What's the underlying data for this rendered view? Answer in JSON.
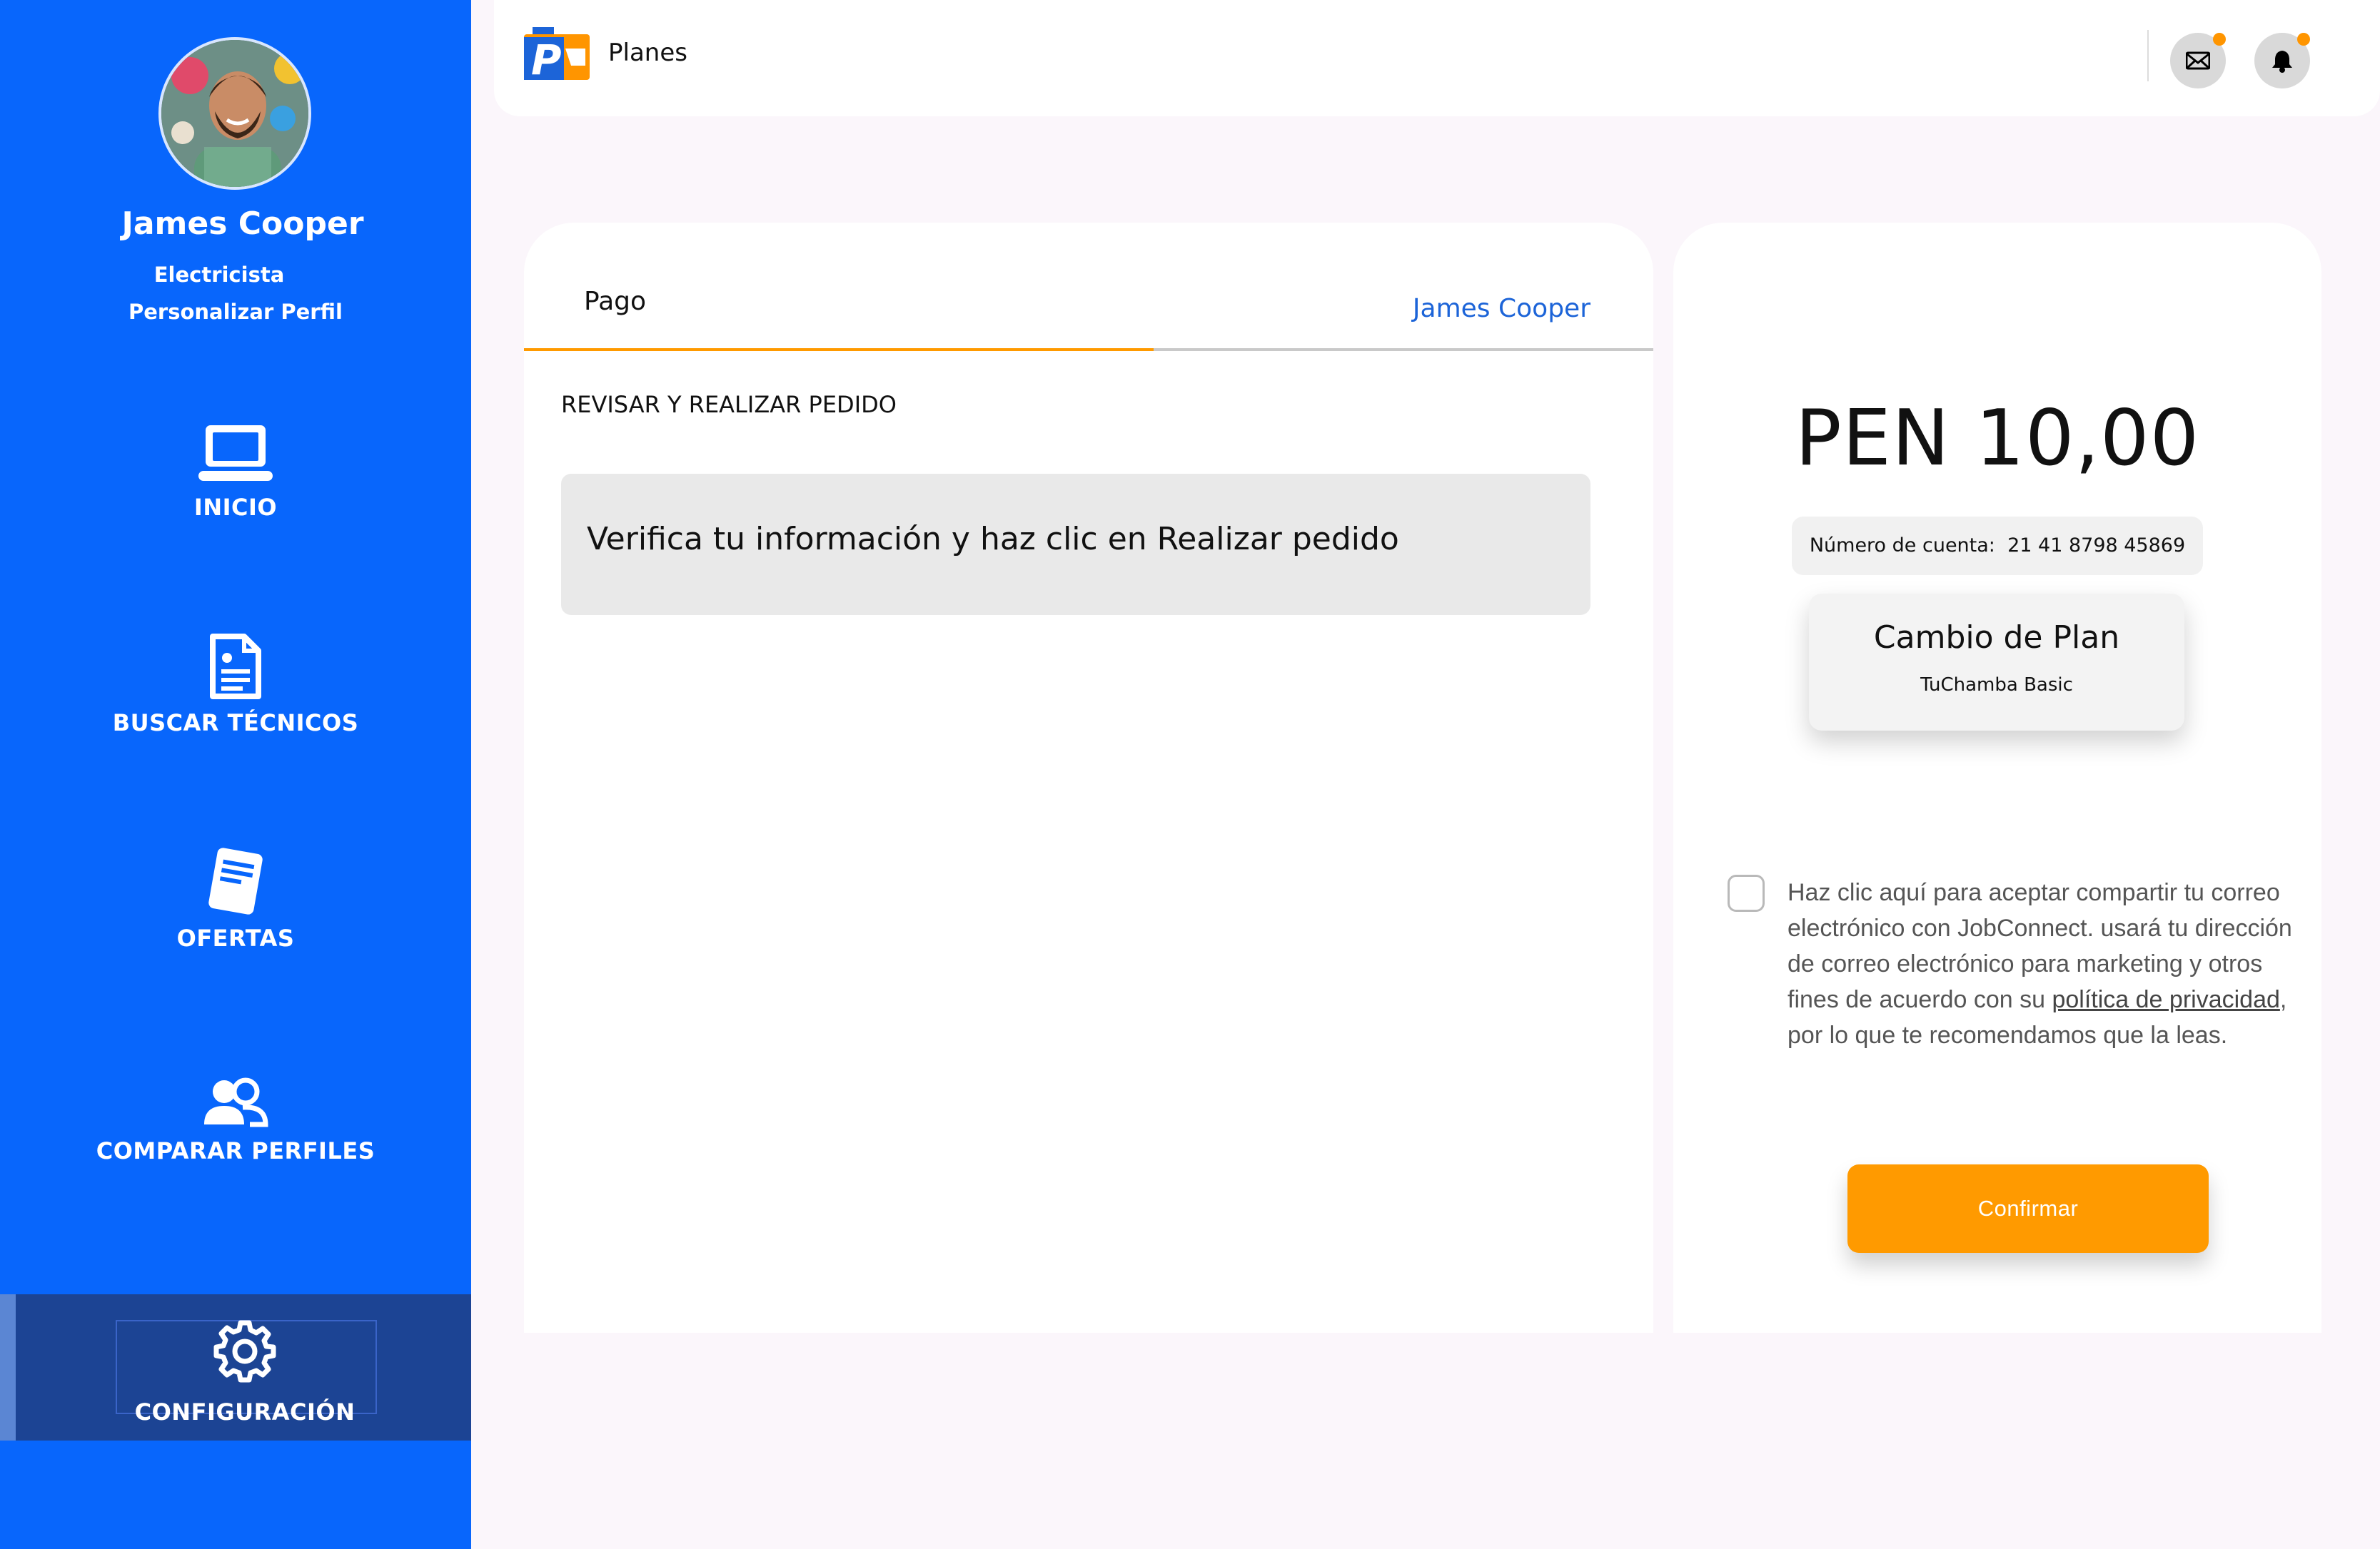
{
  "sidebar": {
    "user": {
      "name": "James Cooper",
      "role": "Electricista",
      "edit_link": "Personalizar Perfil"
    },
    "items": [
      {
        "label": "INICIO",
        "icon": "laptop-icon"
      },
      {
        "label": "BUSCAR TÉCNICOS",
        "icon": "document-icon"
      },
      {
        "label": "OFERTAS",
        "icon": "offer-document-icon"
      },
      {
        "label": "COMPARAR PERFILES",
        "icon": "users-icon"
      },
      {
        "label": "CONFIGURACIÓN",
        "icon": "gear-icon",
        "active": true
      }
    ]
  },
  "header": {
    "title": "Planes",
    "icons": [
      "mail-icon",
      "bell-icon"
    ]
  },
  "checkout": {
    "tab_label": "Pago",
    "tab_user": "James Cooper",
    "section_title": "REVISAR Y REALIZAR PEDIDO",
    "info_message": "Verifica tu información y haz clic en Realizar pedido"
  },
  "summary": {
    "price": "PEN 10,00",
    "account_label": "Número de cuenta:",
    "account_number": "21 41 8798 45869",
    "plan_title": "Cambio de Plan",
    "plan_name": "TuChamba Basic",
    "consent_text_1": "Haz clic aquí para aceptar compartir tu correo electrónico con JobConnect. usará tu dirección de correo electrónico para marketing y otros fines de acuerdo con su ",
    "consent_link": "política de privacidad",
    "consent_text_2": ", por lo que te recomendamos que la leas.",
    "confirm_label": "Confirmar"
  },
  "colors": {
    "sidebar": "#0866fc",
    "sidebar_active": "#1c4494",
    "accent": "#ff9a00",
    "link": "#1c64d8",
    "background": "#fbf6fb"
  }
}
